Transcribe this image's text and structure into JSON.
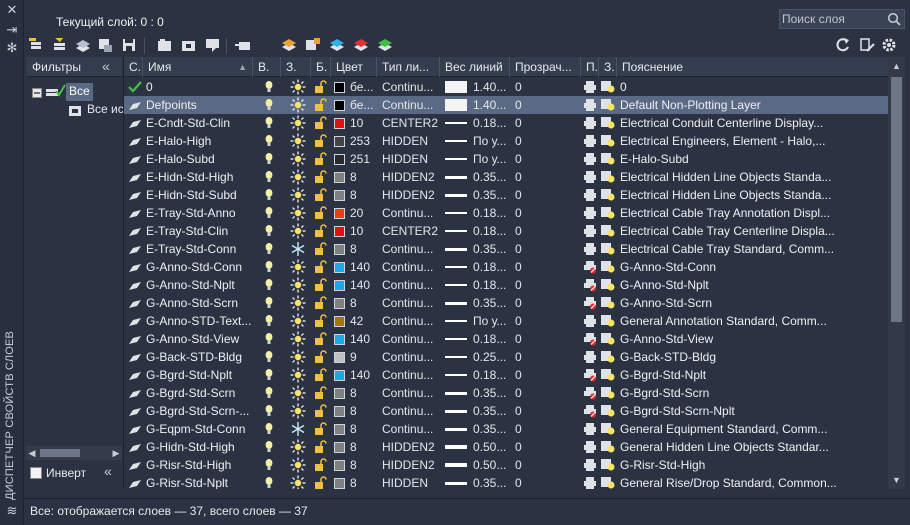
{
  "header": {
    "current_layer": "Текущий слой: 0 : 0",
    "search_placeholder": "Поиск слоя"
  },
  "palette_title": "ДИСПЕТЧЕР СВОЙСТВ СЛОЕВ",
  "filters": {
    "title": "Фильтры",
    "tree_all": "Все",
    "tree_used": "Все ис",
    "invert_label": "Инверт"
  },
  "columns": {
    "status": "С.",
    "name": "Имя",
    "on": "В.",
    "freeze": "З.",
    "lock": "Б.",
    "color": "Цвет",
    "linetype": "Тип ли...",
    "lineweight": "Вес линий",
    "transparency": "Прозрач...",
    "plot": "П.",
    "newvp": "З.",
    "description": "Пояснение"
  },
  "status_text": "Все: отображается слоев — 37, всего слоев — 37",
  "layers": [
    {
      "name": "0",
      "color": "бе...",
      "swatch": "#000000",
      "linetype": "Continu...",
      "lw": "1.40...",
      "lw_style": "wide",
      "transp": "0",
      "desc": "0",
      "current": true,
      "frozen": false,
      "noplot": false
    },
    {
      "name": "Defpoints",
      "color": "бе...",
      "swatch": "#000000",
      "linetype": "Continu...",
      "lw": "1.40...",
      "lw_style": "wide",
      "transp": "0",
      "desc": "Default Non-Plotting Layer",
      "selected": true,
      "frozen": false,
      "noplot": false
    },
    {
      "name": "E-Cndt-Std-Clin",
      "color": "10",
      "swatch": "#e01010",
      "linetype": "CENTER2",
      "lw": "0.18...",
      "lw_style": "thin",
      "transp": "0",
      "desc": "Electrical Conduit Centerline Display...",
      "frozen": false,
      "noplot": false
    },
    {
      "name": "E-Halo-High",
      "color": "253",
      "swatch": "#444444",
      "linetype": "HIDDEN",
      "lw": "По у...",
      "lw_style": "thin",
      "transp": "0",
      "desc": "Electrical Engineers, Element - Halo,...",
      "frozen": false,
      "noplot": false
    },
    {
      "name": "E-Halo-Subd",
      "color": "251",
      "swatch": "#2a2a2a",
      "linetype": "HIDDEN",
      "lw": "По у...",
      "lw_style": "thin",
      "transp": "0",
      "desc": "E-Halo-Subd",
      "frozen": false,
      "noplot": false
    },
    {
      "name": "E-Hidn-Std-High",
      "color": "8",
      "swatch": "#808080",
      "linetype": "HIDDEN2",
      "lw": "0.35...",
      "lw_style": "mid",
      "transp": "0",
      "desc": "Electrical Hidden Line Objects Standa...",
      "frozen": false,
      "noplot": false
    },
    {
      "name": "E-Hidn-Std-Subd",
      "color": "8",
      "swatch": "#808080",
      "linetype": "HIDDEN2",
      "lw": "0.35...",
      "lw_style": "mid",
      "transp": "0",
      "desc": "Electrical Hidden Line Objects Standa...",
      "frozen": false,
      "noplot": false
    },
    {
      "name": "E-Tray-Std-Anno",
      "color": "20",
      "swatch": "#e84010",
      "linetype": "Continu...",
      "lw": "0.18...",
      "lw_style": "thin",
      "transp": "0",
      "desc": "Electrical Cable Tray Annotation Displ...",
      "frozen": false,
      "noplot": false
    },
    {
      "name": "E-Tray-Std-Clin",
      "color": "10",
      "swatch": "#e01010",
      "linetype": "CENTER2",
      "lw": "0.18...",
      "lw_style": "thin",
      "transp": "0",
      "desc": "Electrical Cable Tray Centerline Displa...",
      "frozen": false,
      "noplot": false
    },
    {
      "name": "E-Tray-Std-Conn",
      "color": "8",
      "swatch": "#808080",
      "linetype": "Continu...",
      "lw": "0.35...",
      "lw_style": "mid",
      "transp": "0",
      "desc": "Electrical Cable Tray Standard, Comm...",
      "frozen": true,
      "noplot": false
    },
    {
      "name": "G-Anno-Std-Conn",
      "color": "140",
      "swatch": "#1aa8e8",
      "linetype": "Continu...",
      "lw": "0.18...",
      "lw_style": "thin",
      "transp": "0",
      "desc": "G-Anno-Std-Conn",
      "frozen": false,
      "noplot": true
    },
    {
      "name": "G-Anno-Std-Nplt",
      "color": "140",
      "swatch": "#1aa8e8",
      "linetype": "Continu...",
      "lw": "0.18...",
      "lw_style": "thin",
      "transp": "0",
      "desc": "G-Anno-Std-Nplt",
      "frozen": false,
      "noplot": true
    },
    {
      "name": "G-Anno-Std-Scrn",
      "color": "8",
      "swatch": "#808080",
      "linetype": "Continu...",
      "lw": "0.35...",
      "lw_style": "mid",
      "transp": "0",
      "desc": "G-Anno-Std-Scrn",
      "frozen": false,
      "noplot": true
    },
    {
      "name": "G-Anno-STD-Text...",
      "color": "42",
      "swatch": "#a07800",
      "linetype": "Continu...",
      "lw": "По у...",
      "lw_style": "thin",
      "transp": "0",
      "desc": "General Annotation Standard, Comm...",
      "frozen": false,
      "noplot": false
    },
    {
      "name": "G-Anno-Std-View",
      "color": "140",
      "swatch": "#1aa8e8",
      "linetype": "Continu...",
      "lw": "0.18...",
      "lw_style": "thin",
      "transp": "0",
      "desc": "G-Anno-Std-View",
      "frozen": false,
      "noplot": true
    },
    {
      "name": "G-Back-STD-Bldg",
      "color": "9",
      "swatch": "#c0c0c0",
      "linetype": "Continu...",
      "lw": "0.25...",
      "lw_style": "thin",
      "transp": "0",
      "desc": "G-Back-STD-Bldg",
      "frozen": false,
      "noplot": false
    },
    {
      "name": "G-Bgrd-Std-Nplt",
      "color": "140",
      "swatch": "#1aa8e8",
      "linetype": "Continu...",
      "lw": "0.18...",
      "lw_style": "thin",
      "transp": "0",
      "desc": "G-Bgrd-Std-Nplt",
      "frozen": false,
      "noplot": true
    },
    {
      "name": "G-Bgrd-Std-Scrn",
      "color": "8",
      "swatch": "#808080",
      "linetype": "Continu...",
      "lw": "0.35...",
      "lw_style": "mid",
      "transp": "0",
      "desc": "G-Bgrd-Std-Scrn",
      "frozen": false,
      "noplot": true
    },
    {
      "name": "G-Bgrd-Std-Scrn-...",
      "color": "8",
      "swatch": "#808080",
      "linetype": "Continu...",
      "lw": "0.35...",
      "lw_style": "mid",
      "transp": "0",
      "desc": "G-Bgrd-Std-Scrn-Nplt",
      "frozen": false,
      "noplot": true
    },
    {
      "name": "G-Eqpm-Std-Conn",
      "color": "8",
      "swatch": "#808080",
      "linetype": "Continu...",
      "lw": "0.35...",
      "lw_style": "mid",
      "transp": "0",
      "desc": "General Equipment Standard, Comm...",
      "frozen": true,
      "noplot": false
    },
    {
      "name": "G-Hidn-Std-High",
      "color": "8",
      "swatch": "#808080",
      "linetype": "HIDDEN2",
      "lw": "0.50...",
      "lw_style": "thick",
      "transp": "0",
      "desc": "General Hidden Line Objects Standar...",
      "frozen": false,
      "noplot": false
    },
    {
      "name": "G-Risr-Std-High",
      "color": "8",
      "swatch": "#808080",
      "linetype": "HIDDEN2",
      "lw": "0.50...",
      "lw_style": "thick",
      "transp": "0",
      "desc": "G-Risr-Std-High",
      "frozen": false,
      "noplot": false
    },
    {
      "name": "G-Risr-Std-Nplt",
      "color": "8",
      "swatch": "#808080",
      "linetype": "HIDDEN",
      "lw": "0.35...",
      "lw_style": "mid",
      "transp": "0",
      "desc": "General Rise/Drop Standard, Common...",
      "frozen": false,
      "noplot": false
    }
  ]
}
